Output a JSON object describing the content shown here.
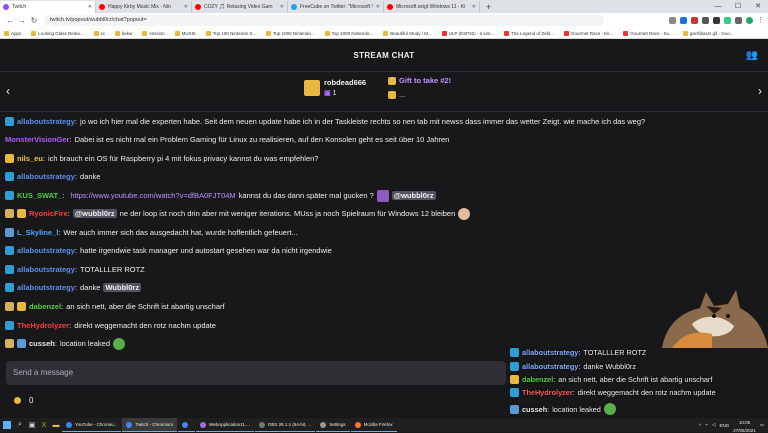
{
  "browser": {
    "tabs": [
      {
        "title": "Twitch",
        "color": "#9146ff",
        "active": true
      },
      {
        "title": "Happy Kirby Music Mix - Nin",
        "color": "#ff0000"
      },
      {
        "title": "COZY 🎵 Relaxing Video Gam",
        "color": "#ff0000"
      },
      {
        "title": "FreeCube on Twitter: \"Microsoft !",
        "color": "#1da1f2"
      },
      {
        "title": "Microsoft zeigt Windows 11 - Ki",
        "color": "#ff0000"
      }
    ],
    "new_tab": "+",
    "address": "twitch.tv/popout/wubbl0rz/chat?popout=",
    "bookmarks": [
      "Apps",
      "Looking Glass Relea...",
      "sc",
      "kekw",
      "session",
      "MUSIK",
      "Top 100 Nintendo S...",
      "Top 1000 Nintendo...",
      "Top 1000 Nintendo...",
      "Beautiful Study / M...",
      "ULP (ESP32) - a sim...",
      "The Legend of Zeld...",
      "Gourmet Race - Kir...",
      "Gourmet Race - Su...",
      "gachibass! gif - Goo..."
    ]
  },
  "chat": {
    "header_title": "STREAM CHAT",
    "gift": {
      "gifter": "robdead666",
      "count": "1",
      "gift_title": "Gift to take #2!",
      "gift_sub": "..."
    },
    "messages": [
      {
        "badges": [
          "prime"
        ],
        "user": "allaboutstrategy",
        "color": "#5b8fe8",
        "text": "jo wo ich hier mal die experten habe. Seit dem neuen update habe ich in der Taskleiste rechts so nen tab mit newss dass immer das wetter Zeigt. wie mache ich das weg?"
      },
      {
        "badges": [],
        "user": "MonsterVisionGer",
        "color": "#b05cff",
        "text": "Dabei ist es nicht mal ein Problem Gaming für Linux zu realisieren, auf den Konsolen geht es seit über 10 Jahren"
      },
      {
        "badges": [
          "gift"
        ],
        "user": "nils_eu",
        "color": "#e8c83f",
        "text": "ich brauch ein OS für Raspberry pi 4 mit fokus privacy kannst du was empfehlen?"
      },
      {
        "badges": [
          "prime"
        ],
        "user": "allaboutstrategy",
        "color": "#5b8fe8",
        "text": "danke"
      },
      {
        "badges": [
          "prime"
        ],
        "user": "KUS_SWAT_",
        "color": "#4cd13a",
        "link": "https://www.youtube.com/watch?v=dfBA0FJT04M",
        "text": "kannst du das dann später mal gucken ?",
        "mention": "@wubbl0rz"
      },
      {
        "badges": [
          "crown",
          "gift"
        ],
        "user": "RyonicFire",
        "color": "#ff3b3b",
        "mention": "@wubbl0rz",
        "text": "ne der loop ist noch drin aber mit weniger iterations. MUss ja noch Spielraum für Windows 12 bleiben"
      },
      {
        "badges": [
          "mod"
        ],
        "user": "L_Skyline_l",
        "color": "#4aa8ff",
        "text": "Wer auch immer sich das ausgedacht hat, wurde hoffentlich gefeuert..."
      },
      {
        "badges": [
          "prime"
        ],
        "user": "allaboutstrategy",
        "color": "#5b8fe8",
        "text": "hatte irgendwie task manager und autostart gesehen war da nicht irgendwie"
      },
      {
        "badges": [
          "prime"
        ],
        "user": "allaboutstrategy",
        "color": "#5b8fe8",
        "text": "TOTALLLER ROTZ"
      },
      {
        "badges": [
          "prime"
        ],
        "user": "allaboutstrategy",
        "color": "#5b8fe8",
        "text": "danke",
        "mention": "Wubbl0rz"
      },
      {
        "badges": [
          "crown",
          "gift"
        ],
        "user": "dabenzel",
        "color": "#4cd13a",
        "text": "an sich nett, aber die Schrift ist abartig unscharf"
      },
      {
        "badges": [
          "prime"
        ],
        "user": "TheHydrolyzer",
        "color": "#ff3b3b",
        "text": "direkt weggemacht den rotz nachm update"
      },
      {
        "badges": [
          "crown",
          "mod"
        ],
        "user": "cusseh",
        "color": "#e8e8e8",
        "text": "location leaked"
      }
    ],
    "send_placeholder": "Send a message",
    "points": "0"
  },
  "overlay": [
    {
      "badges": [
        "prime"
      ],
      "user": "allaboutstrategy",
      "color": "#7fb0ff",
      "text": "TOTALLLER ROTZ"
    },
    {
      "badges": [
        "prime"
      ],
      "user": "allaboutstrategy",
      "color": "#7fb0ff",
      "text": "danke Wubbl0rz"
    },
    {
      "badges": [
        "gift"
      ],
      "user": "dabenzel",
      "color": "#4cd13a",
      "text": "an sich nett, aber die Schrift ist abartig unscharf"
    },
    {
      "badges": [
        "prime"
      ],
      "user": "TheHydrolyzer",
      "color": "#ff5a5a",
      "text": "direkt weggemacht den rotz nachm update"
    },
    {
      "badges": [
        "mod"
      ],
      "user": "cusseh",
      "color": "#e8e8e8",
      "text": "location leaked"
    }
  ],
  "taskbar": {
    "apps": [
      {
        "label": "YouTube - Chromiu...",
        "color": "#4285f4"
      },
      {
        "label": "Twitch - Chromium",
        "color": "#4285f4",
        "active": true
      },
      {
        "label": "",
        "color": "#4285f4"
      },
      {
        "label": "WebApplication11....",
        "color": "#a070e0"
      },
      {
        "label": "OBS 26.1.1 (64-bit, ...",
        "color": "#777"
      },
      {
        "label": "Settings",
        "color": "#999"
      },
      {
        "label": "Mozilla Firefox",
        "color": "#ff7139"
      }
    ],
    "lang": "ENG",
    "time": "10:06",
    "date": "27/06/2021"
  }
}
